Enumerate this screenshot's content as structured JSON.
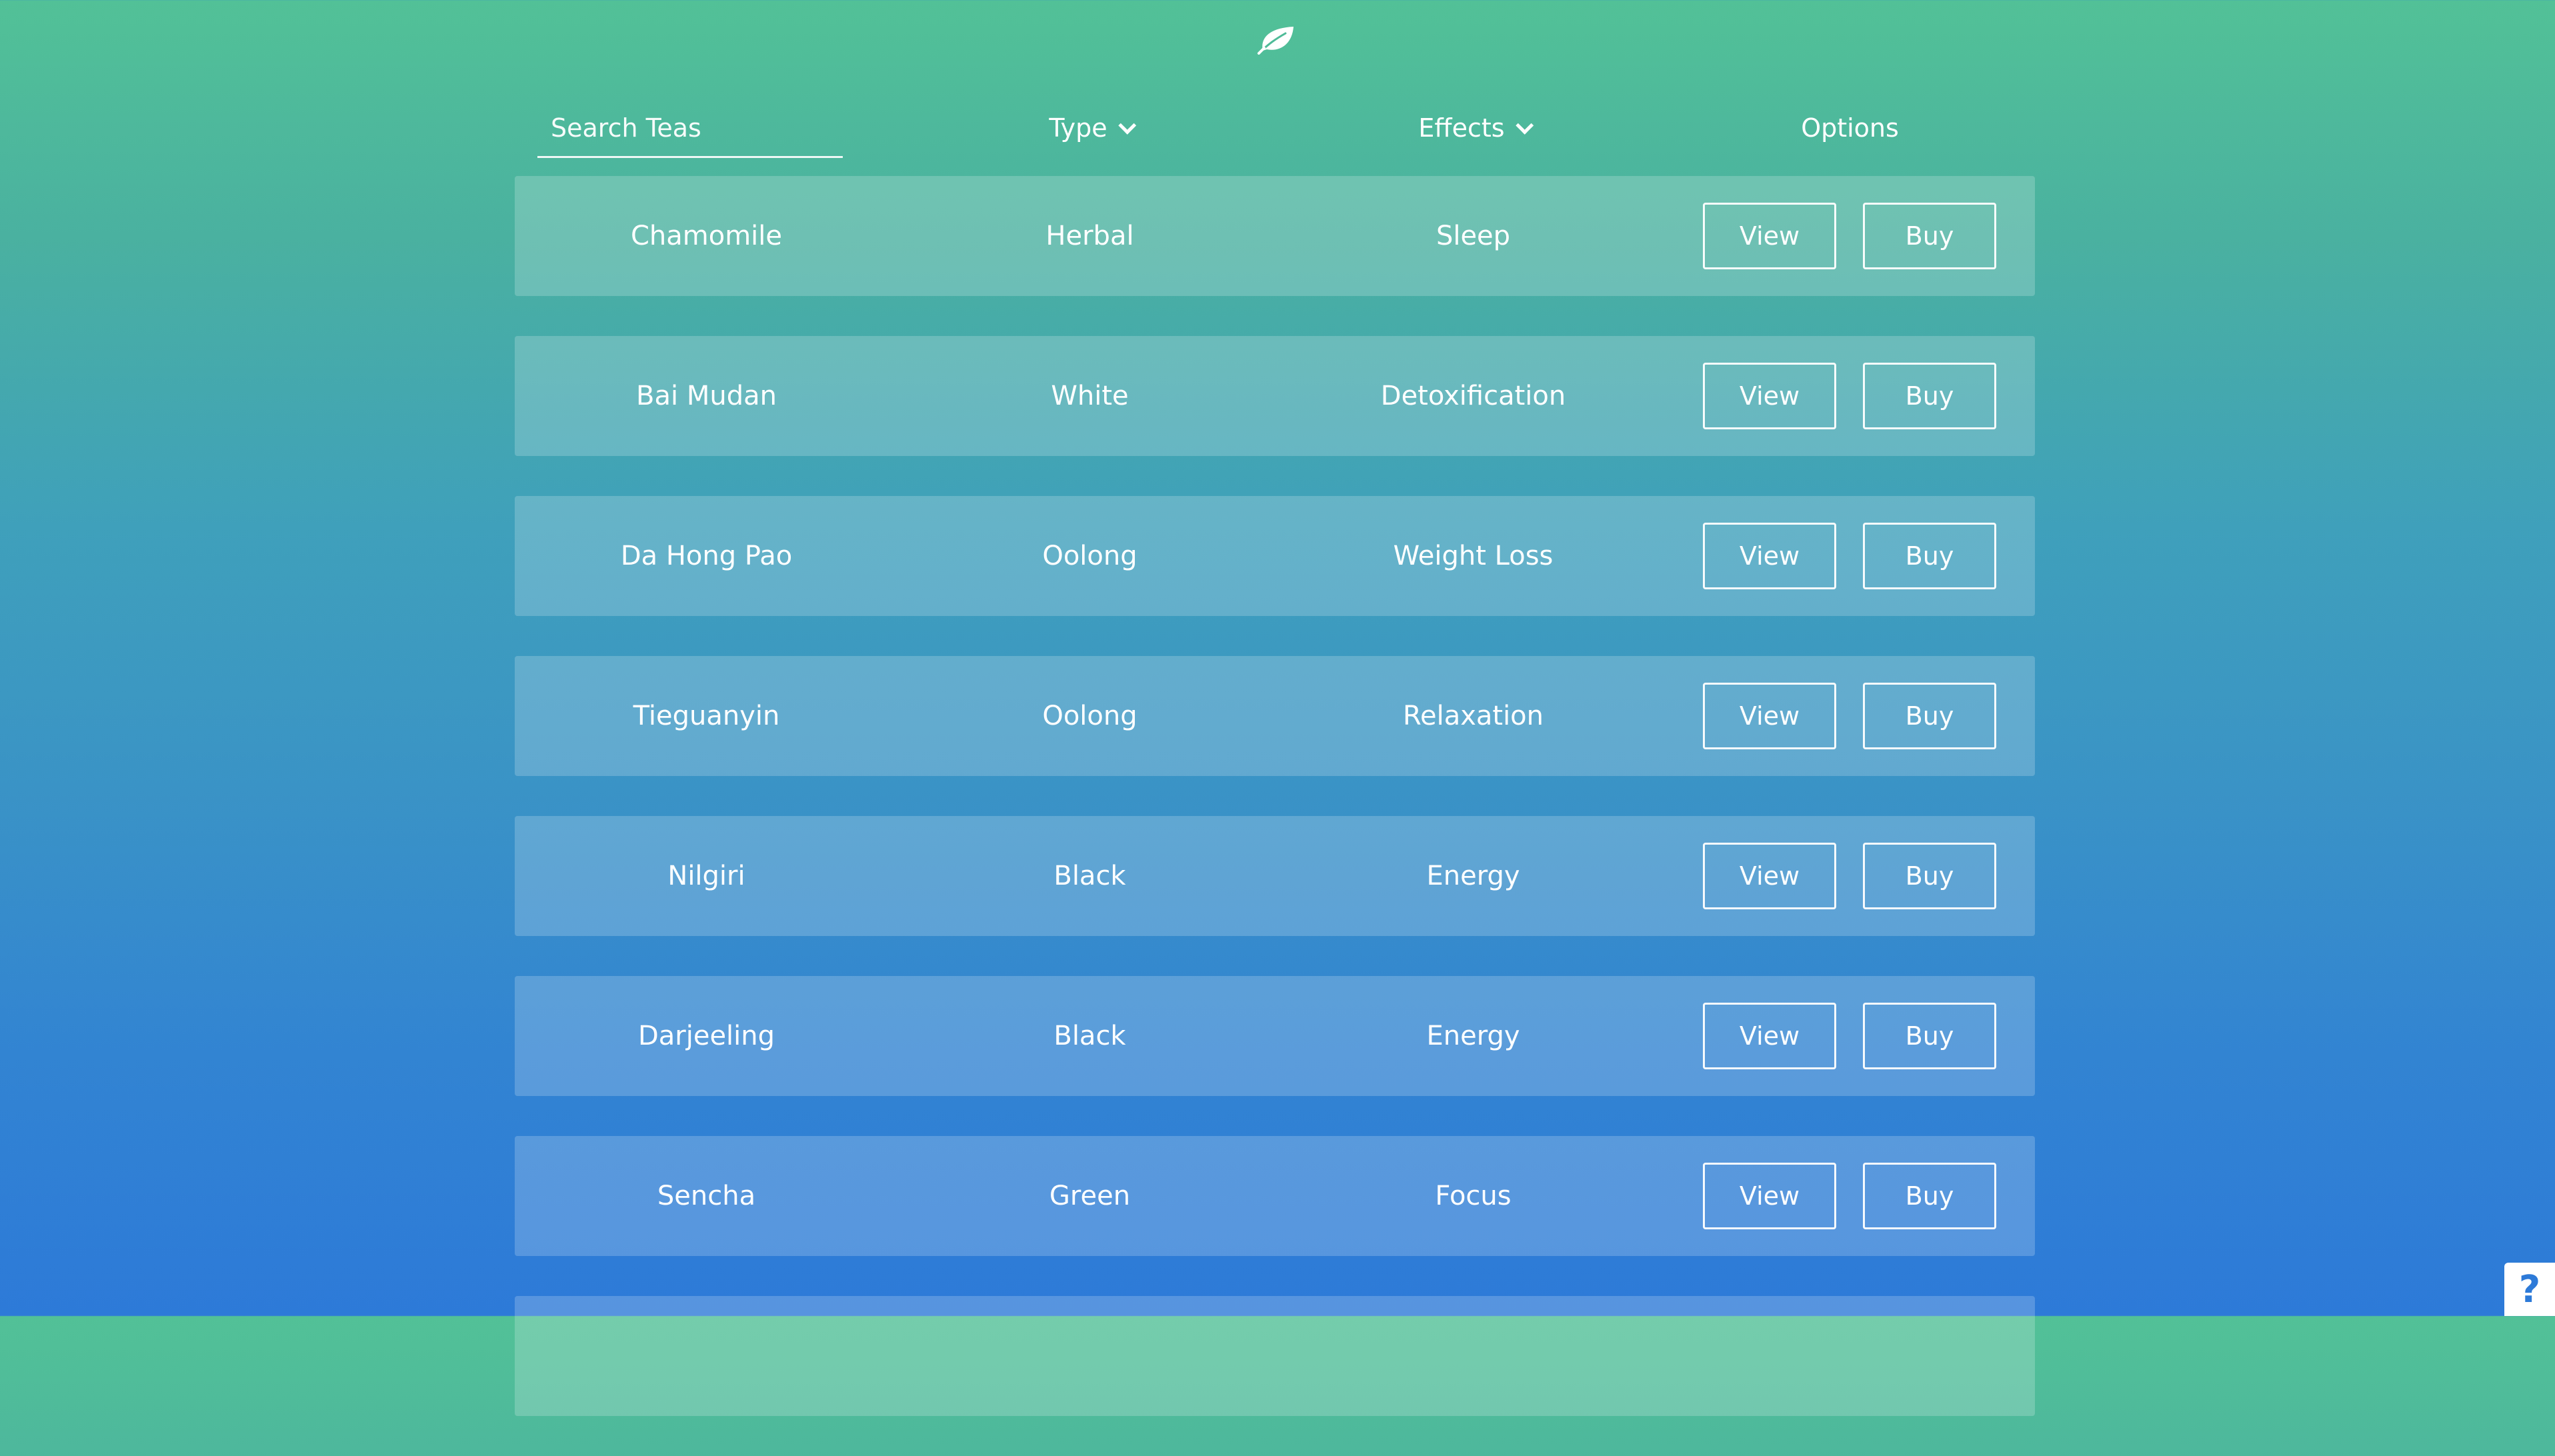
{
  "header": {
    "logo_icon": "leaf-icon",
    "search_placeholder": "Search Teas",
    "search_value": "",
    "type_label": "Type",
    "effects_label": "Effects",
    "options_label": "Options"
  },
  "rows": [
    {
      "name": "Chamomile",
      "type": "Herbal",
      "effect": "Sleep",
      "view": "View",
      "buy": "Buy"
    },
    {
      "name": "Bai Mudan",
      "type": "White",
      "effect": "Detoxification",
      "view": "View",
      "buy": "Buy"
    },
    {
      "name": "Da Hong Pao",
      "type": "Oolong",
      "effect": "Weight Loss",
      "view": "View",
      "buy": "Buy"
    },
    {
      "name": "Tieguanyin",
      "type": "Oolong",
      "effect": "Relaxation",
      "view": "View",
      "buy": "Buy"
    },
    {
      "name": "Nilgiri",
      "type": "Black",
      "effect": "Energy",
      "view": "View",
      "buy": "Buy"
    },
    {
      "name": "Darjeeling",
      "type": "Black",
      "effect": "Energy",
      "view": "View",
      "buy": "Buy"
    },
    {
      "name": "Sencha",
      "type": "Green",
      "effect": "Focus",
      "view": "View",
      "buy": "Buy"
    },
    {
      "name": "",
      "type": "",
      "effect": "",
      "view": "",
      "buy": ""
    }
  ],
  "help": {
    "label": "?",
    "icon": "help-icon"
  },
  "colors": {
    "gradient_top": "#52c197",
    "gradient_bottom": "#2d7ad8",
    "text": "#ffffff"
  }
}
